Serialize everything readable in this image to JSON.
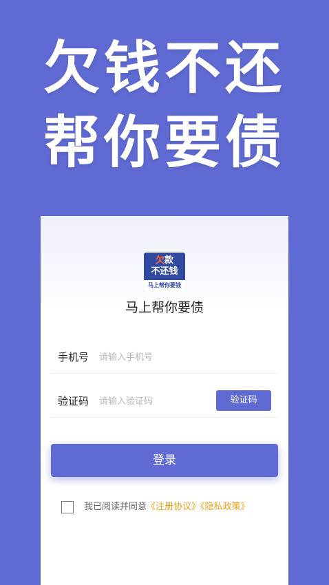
{
  "hero": {
    "line1": "欠钱不还",
    "line2": "帮你要债"
  },
  "logo": {
    "top_accent": "欠",
    "top_rest": "款",
    "middle": "不还钱",
    "subtitle": "马上帮你要钱"
  },
  "card": {
    "title": "马上帮你要债"
  },
  "form": {
    "phone_label": "手机号",
    "phone_placeholder": "请输入手机号",
    "code_label": "验证码",
    "code_placeholder": "请输入验证码",
    "code_button": "验证码",
    "login_button": "登录"
  },
  "agreement": {
    "checked": false,
    "prefix": "我已阅读并同意",
    "link1": "《注册协议》",
    "link2": "《隐私政策》"
  },
  "colors": {
    "background": "#5f6ad2",
    "primary": "#5f6ad2",
    "link": "#e6a21b",
    "logo_bg": "#2f4aa0"
  }
}
